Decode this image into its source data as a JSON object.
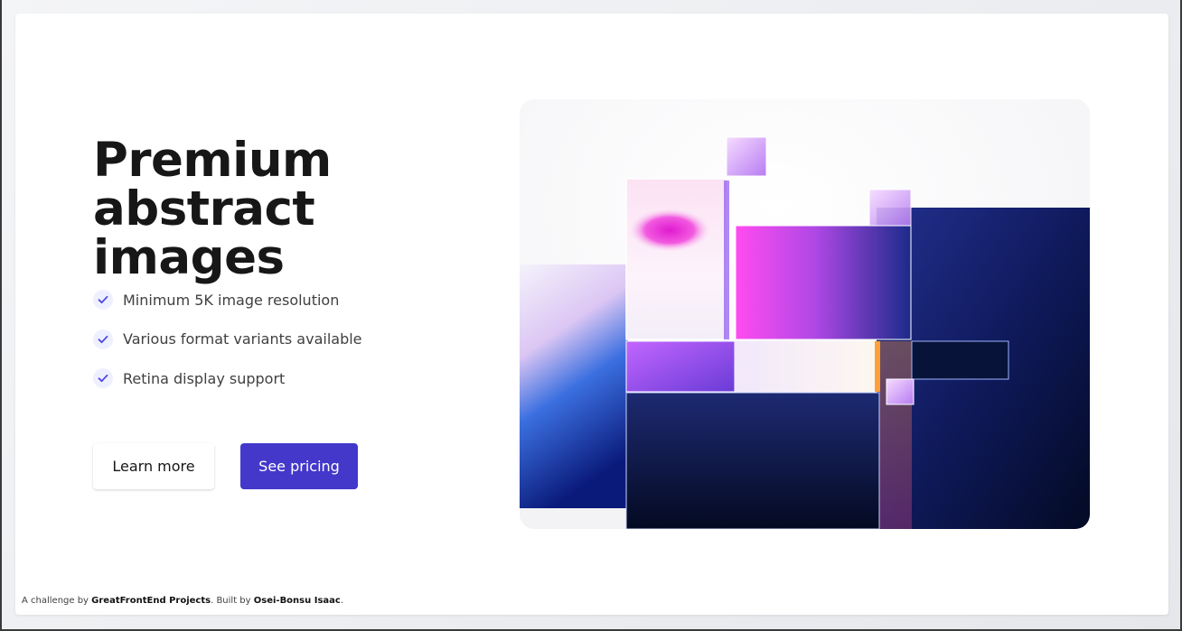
{
  "hero": {
    "title_line1": "Premium",
    "title_line2": "abstract images",
    "features": [
      "Minimum 5K image resolution",
      "Various format variants available",
      "Retina display support"
    ],
    "secondary_button": "Learn more",
    "primary_button": "See pricing"
  },
  "footer": {
    "prefix": "A challenge by ",
    "org": "GreatFrontEnd Projects",
    "middle": ". Built by ",
    "author": "Osei-Bonsu Isaac",
    "suffix": "."
  },
  "colors": {
    "accent": "#4338ca",
    "text": "#171717",
    "check_bg": "#eef0ff",
    "check": "#4f46e5"
  }
}
